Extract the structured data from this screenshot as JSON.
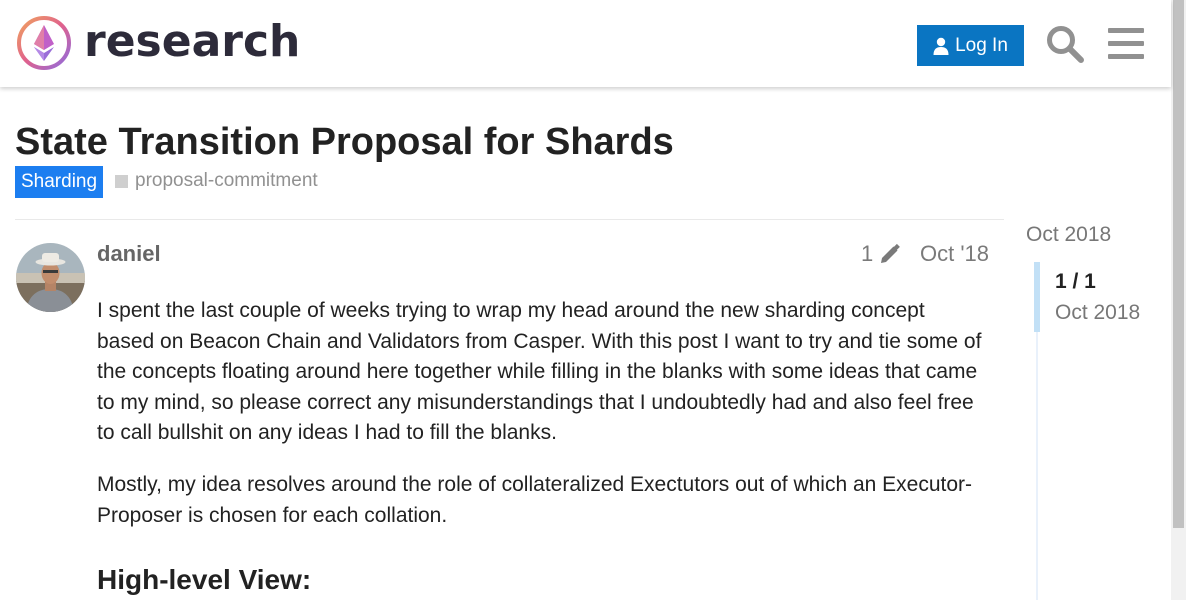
{
  "header": {
    "site_name": "research",
    "login_label": "Log In"
  },
  "topic": {
    "title": "State Transition Proposal for Shards",
    "category": "Sharding",
    "category_color": "#1c7ef0",
    "tags": [
      "proposal-commitment"
    ]
  },
  "post": {
    "username": "daniel",
    "edit_count": "1",
    "date": "Oct '18",
    "paragraphs": [
      "I spent the last couple of weeks trying to wrap my head around the new sharding concept based on Beacon Chain and Validators from Casper. With this post I want to try and tie some of the concepts floating around here together while filling in the blanks with some ideas that came to my mind, so please correct any misunderstandings that I undoubtedly had and also feel free to call bullshit on any ideas I had to fill the blanks.",
      "Mostly, my idea resolves around the role of collateralized Exectutors out of which an Executor-Proposer is chosen for each collation."
    ],
    "heading": "High-level View:"
  },
  "timeline": {
    "start_label": "Oct 2018",
    "position": "1 / 1",
    "date_label": "Oct 2018"
  },
  "icons": {
    "logo": "ethereum-logo-icon",
    "user": "user-icon",
    "search": "search-icon",
    "menu": "hamburger-menu-icon",
    "edit": "pencil-icon"
  },
  "colors": {
    "primary_button": "#0a75c2",
    "text": "#222222",
    "muted": "#777777"
  }
}
